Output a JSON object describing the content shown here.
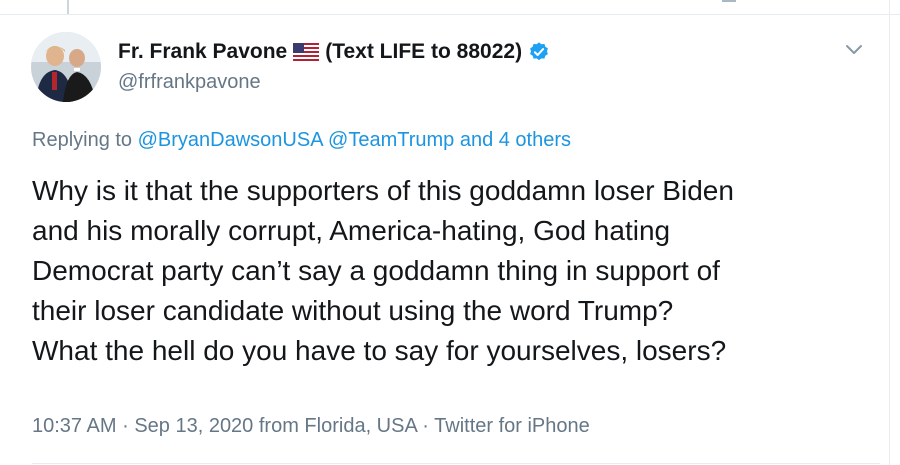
{
  "author": {
    "name": "Fr. Frank Pavone",
    "bio_suffix": "(Text LIFE to 88022)",
    "handle": "@frfrankpavone"
  },
  "reply": {
    "prefix": "Replying to",
    "mentions": [
      "@BryanDawsonUSA",
      "@TeamTrump"
    ],
    "others": "and 4 others"
  },
  "tweet": {
    "lines": [
      "Why is it that the supporters of this goddamn loser Biden",
      "and his morally corrupt, America-hating,  God hating",
      "Democrat party can’t say a goddamn thing in support of",
      "their loser candidate without using the word Trump?",
      "What the hell do you have to say for yourselves, losers?"
    ]
  },
  "meta": {
    "time": "10:37 AM",
    "sep1": "·",
    "date": "Sep 13, 2020",
    "location": "from Florida, USA",
    "sep2": "·",
    "source": "Twitter for iPhone"
  },
  "colors": {
    "link": "#1b95e0",
    "muted": "#657786",
    "text": "#14171a",
    "verified": "#1da1f2"
  }
}
